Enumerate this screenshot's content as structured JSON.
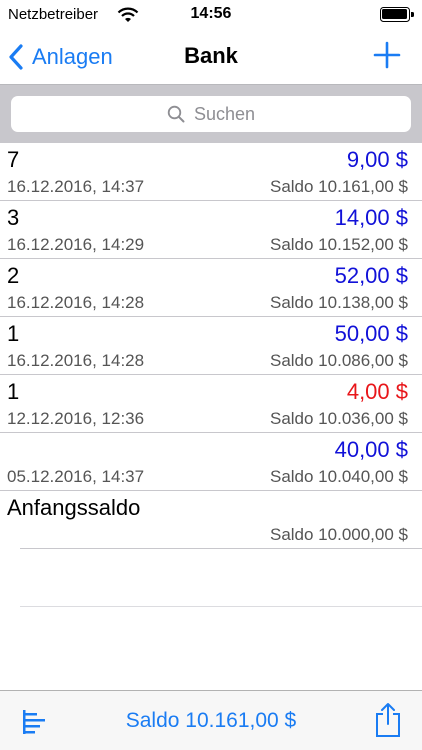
{
  "status_bar": {
    "carrier": "Netzbetreiber",
    "time": "14:56"
  },
  "nav": {
    "back_label": "Anlagen",
    "title": "Bank"
  },
  "search": {
    "placeholder": "Suchen"
  },
  "transactions": [
    {
      "title": "7",
      "amount": "9,00 $",
      "amount_color": "#1111d8",
      "date": "16.12.2016, 14:37",
      "saldo": "Saldo 10.161,00 $"
    },
    {
      "title": "3",
      "amount": "14,00 $",
      "amount_color": "#1111d8",
      "date": "16.12.2016, 14:29",
      "saldo": "Saldo 10.152,00 $"
    },
    {
      "title": "2",
      "amount": "52,00 $",
      "amount_color": "#1111d8",
      "date": "16.12.2016, 14:28",
      "saldo": "Saldo 10.138,00 $"
    },
    {
      "title": "1",
      "amount": "50,00 $",
      "amount_color": "#1111d8",
      "date": "16.12.2016, 14:28",
      "saldo": "Saldo 10.086,00 $"
    },
    {
      "title": "1",
      "amount": "4,00 $",
      "amount_color": "#e8161a",
      "date": "12.12.2016, 12:36",
      "saldo": "Saldo 10.036,00 $"
    },
    {
      "title": "",
      "amount": "40,00 $",
      "amount_color": "#1111d8",
      "date": "05.12.2016, 14:37",
      "saldo": "Saldo 10.040,00 $"
    }
  ],
  "opening_balance": {
    "title": "Anfangssaldo",
    "saldo": "Saldo 10.000,00 $"
  },
  "toolbar": {
    "saldo": "Saldo 10.161,00 $",
    "sort_icon": "sort-bars-icon",
    "share_icon": "share-icon"
  },
  "colors": {
    "accent": "#1a7cf3",
    "income": "#1111d8",
    "expense": "#e8161a"
  }
}
